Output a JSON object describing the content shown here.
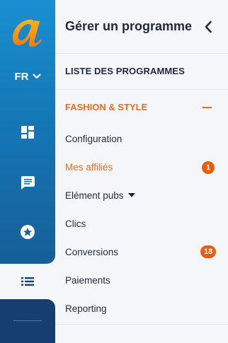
{
  "rail": {
    "logo_icon": "a-letter-logo",
    "language": "FR",
    "icons": [
      "dashboard-icon",
      "chat-bubble-icon",
      "star-badge-icon",
      "list-icon"
    ],
    "brand_orange": "#f28a17",
    "rail_blue_top": "#1a8fd0",
    "rail_blue_bottom": "#163f6f"
  },
  "panel": {
    "title": "Gérer un programme",
    "all_programs_label": "LISTE DES PROGRAMMES",
    "program_name": "FASHION & STYLE",
    "menu": [
      {
        "label": "Configuration"
      },
      {
        "label": "Mes affiliés",
        "badge": "1"
      },
      {
        "label": "Elément pubs"
      },
      {
        "label": "Clics"
      },
      {
        "label": "Conversions",
        "badge": "18"
      },
      {
        "label": "Paiements"
      },
      {
        "label": "Reporting"
      }
    ],
    "accent_color": "#ef6c1a",
    "badge_color": "#ea5b0c"
  }
}
